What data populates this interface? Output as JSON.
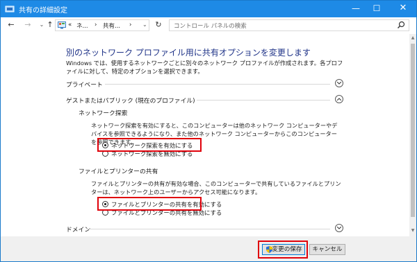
{
  "window": {
    "title": "共有の詳細設定",
    "minimize": "—",
    "maximize": "☐",
    "close": "✕"
  },
  "nav": {
    "back": "←",
    "forward": "→",
    "history": "⌄",
    "up": "↑",
    "refresh": "↻"
  },
  "address": {
    "crumbs": [
      "«",
      "ネ...",
      "›",
      "共有...",
      "›"
    ],
    "dropdown": "⌄"
  },
  "search": {
    "placeholder": "コントロール パネルの検索"
  },
  "main": {
    "heading": "別のネットワーク プロファイル用に共有オプションを変更します",
    "description": "Windows では、使用するネットワークごとに別々のネットワーク プロファイルが作成されます。各プロファイルに対して、特定のオプションを選択できます。",
    "profiles": {
      "private": {
        "label": "プライベート"
      },
      "guest": {
        "label": "ゲストまたはパブリック (現在のプロファイル)"
      },
      "domain": {
        "label": "ドメイン"
      }
    },
    "network_discovery": {
      "label": "ネットワーク探索",
      "text": "ネットワーク探索を有効にすると、このコンピューターは他のネットワーク コンピューターやデバイスを参照できるようになり、また他のネットワーク コンピューターからこのコンピューターを参照できます。",
      "option_on": "ネットワーク探索を有効にする",
      "option_off": "ネットワーク探索を無効にする",
      "selected": "on"
    },
    "file_printer_sharing": {
      "label": "ファイルとプリンターの共有",
      "text": "ファイルとプリンターの共有が有効な場合、このコンピューターで共有しているファイルとプリンターは、ネットワーク上のユーザーからアクセス可能になります。",
      "option_on": "ファイルとプリンターの共有を有効にする",
      "option_off": "ファイルとプリンターの共有を無効にする",
      "selected": "on"
    }
  },
  "footer": {
    "save": "変更の保存",
    "cancel": "キャンセル"
  },
  "colors": {
    "titlebar": "#1e8ae6",
    "heading": "#1e3287",
    "highlight": "#e0000a"
  }
}
